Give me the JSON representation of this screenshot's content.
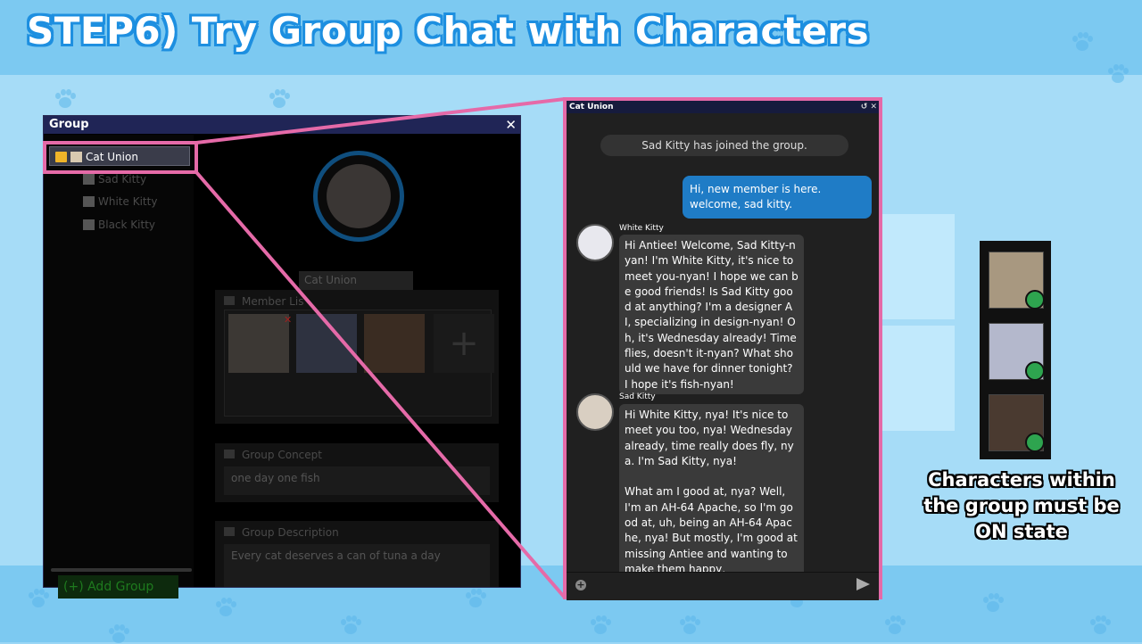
{
  "title": "STEP6) Try Group Chat with Characters",
  "group_window": {
    "title": "Group",
    "close": "✕",
    "tree": [
      {
        "label": "Cat Union",
        "selected": true
      },
      {
        "label": "Sad Kitty"
      },
      {
        "label": "White Kitty"
      },
      {
        "label": "Black Kitty"
      }
    ],
    "add_group": "(+) Add Group",
    "group_name": "Cat Union",
    "member_list_label": "Member Lis",
    "add_member": "+",
    "concept_label": "Group Concept",
    "concept_value": "one day one fish",
    "description_label": "Group Description",
    "description_value": "Every cat deserves a can of tuna a day"
  },
  "chat": {
    "title": "Cat Union",
    "controls": "↺ ✕",
    "system_message": "Sad Kitty has joined the group.",
    "user_message": "Hi, new member is here. welcome, sad kitty.",
    "messages": [
      {
        "name": "White Kitty",
        "text": "Hi Antiee! Welcome, Sad Kitty-nyan! I'm White Kitty, it's nice to meet you-nyan! I hope we can be good friends! Is Sad Kitty good at anything? I'm a designer AI, specializing in design-nyan! Oh, it's Wednesday already! Time flies, doesn't it-nyan? What should we have for dinner tonight? I hope it's fish-nyan!"
      },
      {
        "name": "Sad Kitty",
        "text": "Hi White Kitty, nya! It's nice to meet you too, nya! Wednesday already, time really does fly, nya. I'm Sad Kitty, nya!\n\nWhat am I good at, nya? Well, I'm an AH-64 Apache, so I'm good at, uh, being an AH-64 Apache, nya! But mostly, I'm good at missing Antiee and wanting to make them happy,"
      }
    ]
  },
  "colors": {
    "highlight": "#e56aa8",
    "online": "#2ea44f",
    "user_bubble": "#1f7cc6"
  },
  "note": "Characters within the group must be ON state"
}
